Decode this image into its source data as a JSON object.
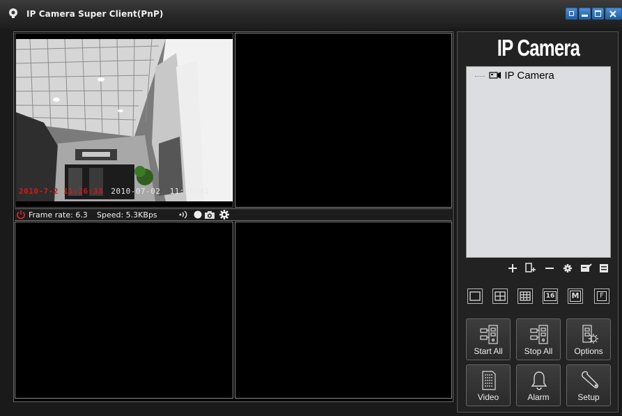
{
  "window": {
    "title": "IP Camera Super Client(PnP)"
  },
  "brand": "IP Camera",
  "device_tree": {
    "root_label": "IP Camera"
  },
  "camera1": {
    "osd_red": "2010-7-2 11:26:33",
    "osd_white_date": "2010-07-02",
    "osd_white_time": "11:26:41",
    "frame_rate_label": "Frame rate: 6.3",
    "speed_label": "Speed: 5.3KBps"
  },
  "actions": {
    "start_all": "Start All",
    "stop_all": "Stop All",
    "options": "Options",
    "video": "Video",
    "alarm": "Alarm",
    "setup": "Setup"
  },
  "view_layouts": [
    "1",
    "4",
    "9",
    "16",
    "M",
    "F"
  ],
  "colors": {
    "titlebar": "#262626",
    "window_buttons": "#1d5ea8",
    "osd_red": "#d51818",
    "panel_bg": "#222222"
  }
}
